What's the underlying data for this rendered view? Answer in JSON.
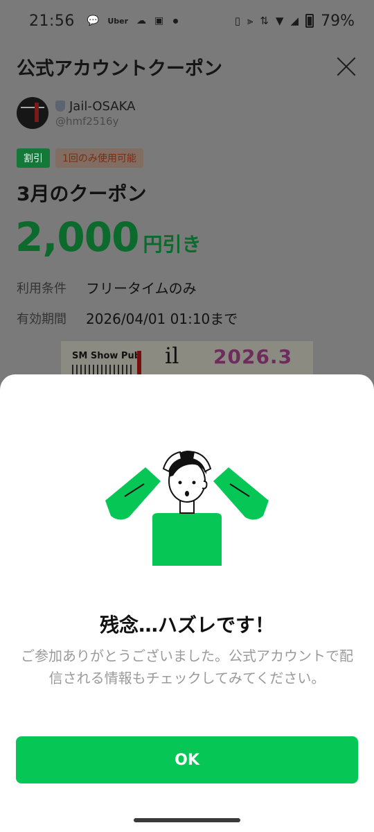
{
  "status_bar": {
    "time": "21:56",
    "notif_icons": [
      "chat-plus-icon",
      "uber-icon",
      "weather-icon",
      "app-d-icon"
    ],
    "uber_label": "Uber",
    "battery": "79%"
  },
  "header": {
    "title": "公式アカウントクーポン"
  },
  "account": {
    "name": "Jail-OSAKA",
    "handle": "@hmf2516y"
  },
  "coupon": {
    "badge_type": "割引",
    "badge_usage": "1回のみ使用可能",
    "title": "3月のクーポン",
    "amount": "2,000",
    "amount_unit": "円引き",
    "cond_label_1": "利用条件",
    "cond_value_1": "フリータイムのみ",
    "cond_label_2": "有効期間",
    "cond_value_2": "2026/04/01 01:10まで"
  },
  "banner": {
    "left_text": "SM Show Pub",
    "mid_text": "il",
    "date_text": "2026.3"
  },
  "result": {
    "title": "残念…ハズレです！",
    "message": "ご参加ありがとうございました。公式アカウントで配信される情報もチェックしてみてください。",
    "ok_label": "OK"
  },
  "colors": {
    "accent": "#06c755",
    "dim_overlay": "#7a7a7a"
  }
}
